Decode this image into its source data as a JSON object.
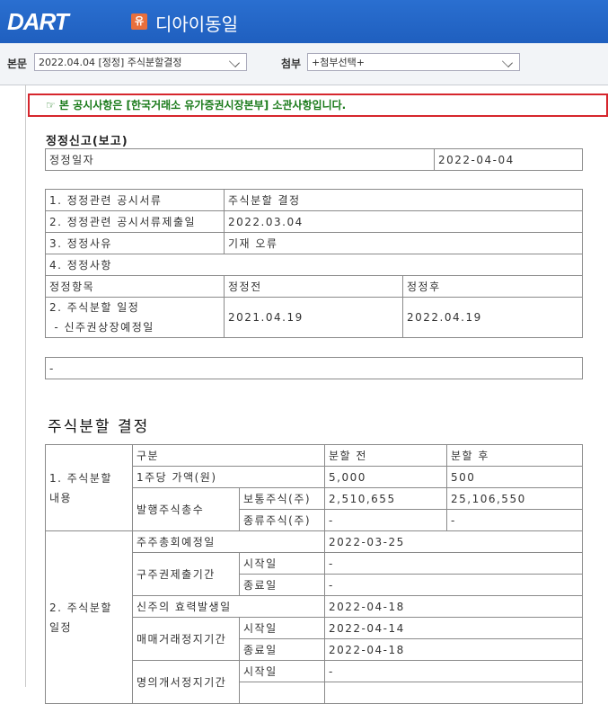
{
  "header": {
    "logo": "DART",
    "badge": "유",
    "company": "디아이동일"
  },
  "selectors": {
    "main_label": "본문",
    "main_value": "2022.04.04 [정정] 주식분할결정",
    "attach_label": "첨부",
    "attach_value": "+첨부선택+"
  },
  "notice": "☞ 본 공시사항은 [한국거래소 유가증권시장본부] 소관사항입니다.",
  "correction": {
    "title": "정정신고(보고)",
    "date_label": "정정일자",
    "date_value": "2022-04-04",
    "rows": [
      {
        "label": "1. 정정관련 공시서류",
        "value": "주식분할 결정"
      },
      {
        "label": "2. 정정관련 공시서류제출일",
        "value": "2022.03.04"
      },
      {
        "label": "3. 정정사유",
        "value": "기재 오류"
      }
    ],
    "items_label": "4. 정정사항",
    "col_item": "정정항목",
    "col_before": "정정전",
    "col_after": "정정후",
    "item_line1": "2. 주식분할 일정",
    "item_line2": " - 신주권상장예정일",
    "before": "2021.04.19",
    "after": "2022.04.19",
    "remark": "-"
  },
  "split": {
    "title": "주식분할 결정",
    "sec1": "1. 주식분할\n내용",
    "h_gubun": "구분",
    "h_before": "분할 전",
    "h_after": "분할 후",
    "par_label": "1주당 가액(원)",
    "par_before": "5,000",
    "par_after": "500",
    "issued_label": "발행주식총수",
    "common_label": "보통주식(주)",
    "common_before": "2,510,655",
    "common_after": "25,106,550",
    "pref_label": "종류주식(주)",
    "pref_before": "-",
    "pref_after": "-",
    "sec2": "2. 주식분할\n일정",
    "meeting_label": "주주총회예정일",
    "meeting_value": "2022-03-25",
    "submit_label": "구주권제출기간",
    "start_label": "시작일",
    "end_label": "종료일",
    "submit_start": "-",
    "submit_end": "-",
    "effective_label": "신주의 효력발생일",
    "effective_value": "2022-04-18",
    "halt_label": "매매거래정지기간",
    "halt_start": "2022-04-14",
    "halt_end": "2022-04-18",
    "transfer_label": "명의개서정지기간",
    "transfer_start": "-"
  }
}
